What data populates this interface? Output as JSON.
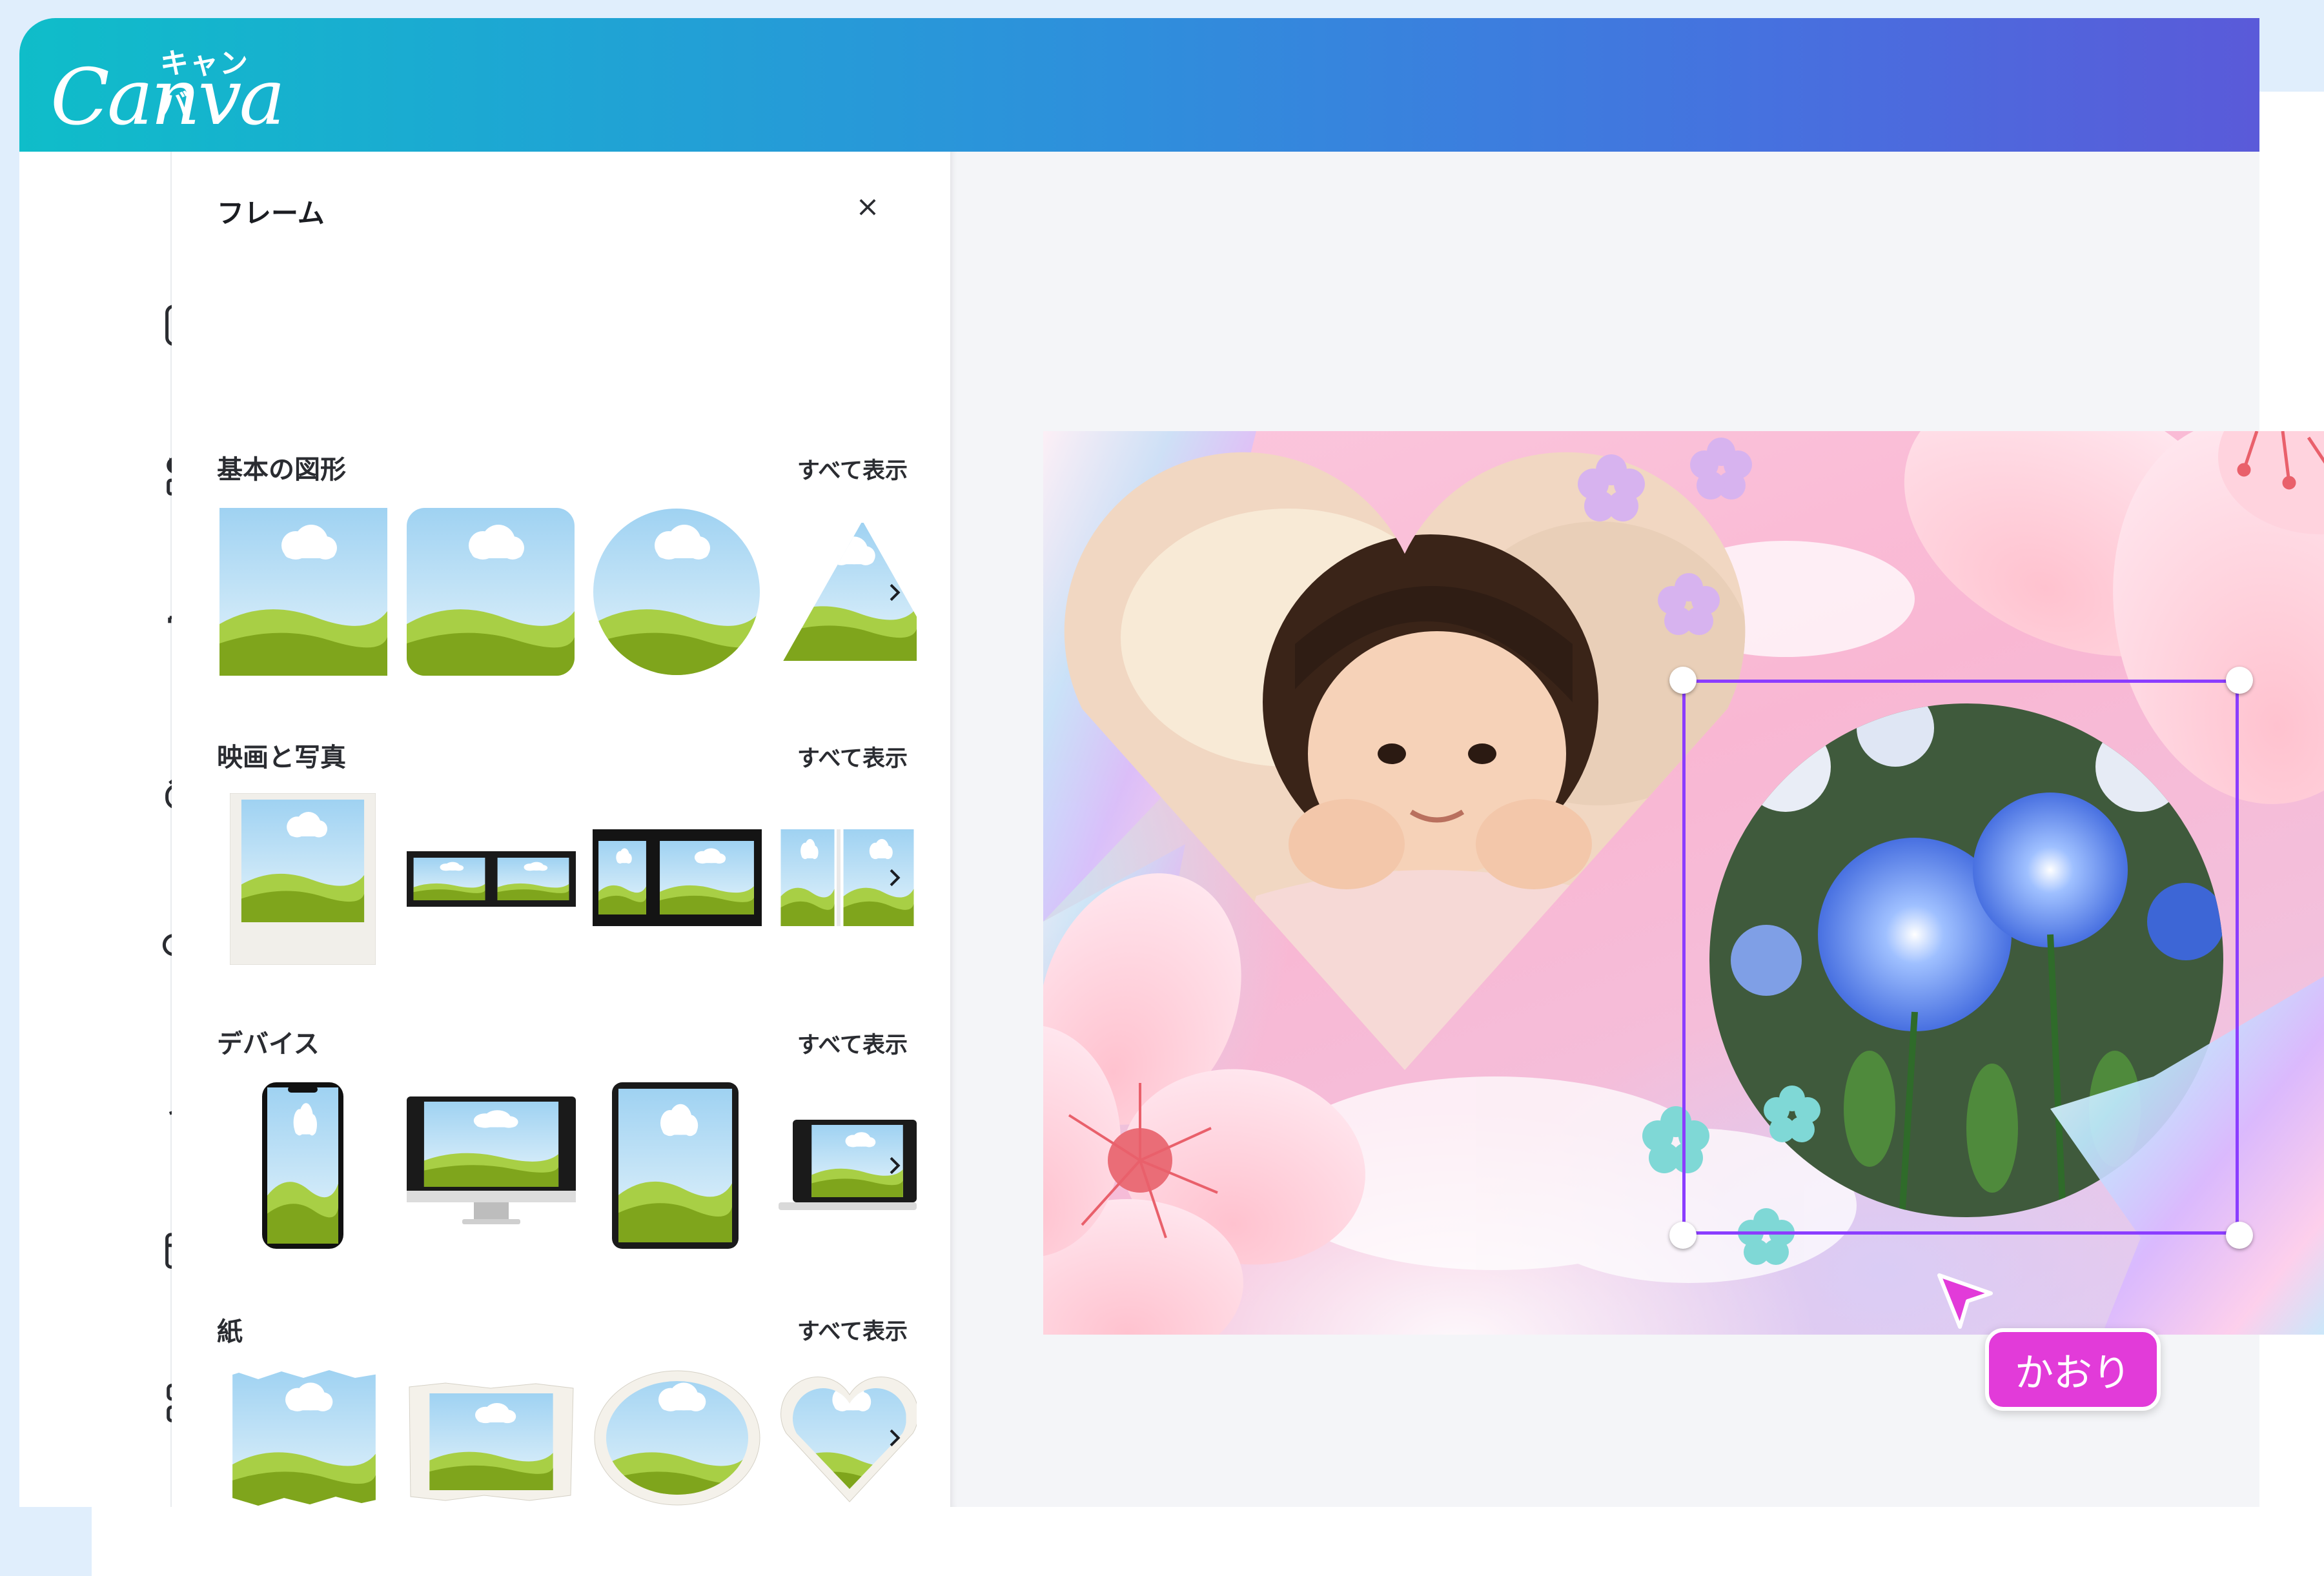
{
  "app": {
    "logo_word": "Canva",
    "logo_kana": "キャンバ",
    "accent": "#8b3dff"
  },
  "rail": {
    "items": [
      {
        "icon": "layout-icon"
      },
      {
        "icon": "shapes-icon"
      },
      {
        "icon": "text-icon"
      },
      {
        "icon": "brand-icon"
      },
      {
        "icon": "upload-icon"
      },
      {
        "icon": "draw-icon"
      },
      {
        "icon": "folder-icon"
      },
      {
        "icon": "apps-icon"
      }
    ]
  },
  "panel": {
    "title": "フレーム",
    "sections": [
      {
        "title": "基本の図形",
        "see_all": "すべて表示"
      },
      {
        "title": "映画と写真",
        "see_all": "すべて表示"
      },
      {
        "title": "デバイス",
        "see_all": "すべて表示"
      },
      {
        "title": "紙",
        "see_all": "すべて表示"
      }
    ]
  },
  "canvas": {
    "collaborator_name": "かおり",
    "collaborator_color": "#e23bd9"
  }
}
